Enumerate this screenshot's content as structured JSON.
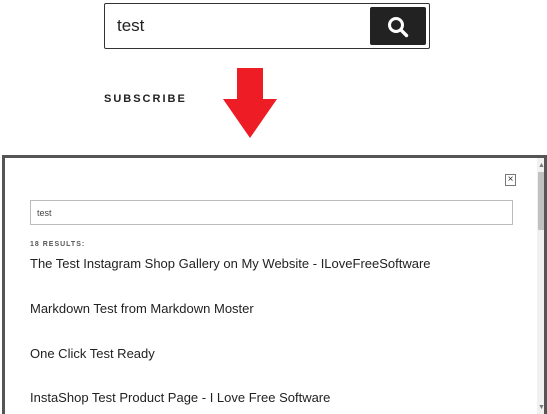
{
  "top_search": {
    "value": "test",
    "button_icon": "search-icon"
  },
  "subscribe_label": "SUBSCRIBE",
  "arrow": {
    "color": "#ee1c24",
    "icon": "down-arrow-icon"
  },
  "modal": {
    "close_symbol": "×",
    "search_value": "test",
    "results_count": "18 RESULTS:",
    "results": [
      "The Test Instagram Shop Gallery on My Website - ILoveFreeSoftware",
      "Markdown Test from Markdown Moster",
      "One Click Test Ready",
      "InstaShop Test Product Page - I Love Free Software"
    ]
  },
  "scrollbar": {
    "up_symbol": "▲",
    "down_symbol": "▼"
  }
}
